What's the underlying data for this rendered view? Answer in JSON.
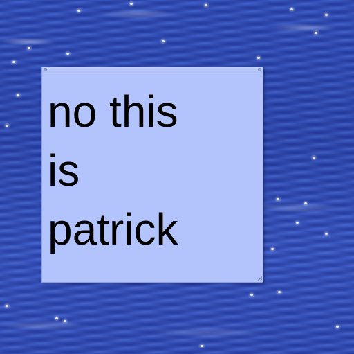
{
  "desktop": {
    "wallpaper": "ocean water"
  },
  "sticky_note": {
    "text": "no this\nis\npatrick",
    "background_color": "#b3c3fb",
    "text_color": "#000000"
  }
}
